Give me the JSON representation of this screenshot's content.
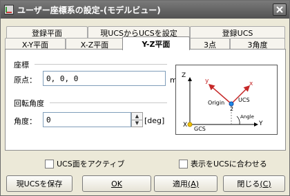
{
  "window": {
    "title": "ユーザー座標系の設定-(モデルビュー)"
  },
  "tabs": {
    "row1": [
      "登録平面",
      "現UCSからUCSを設定",
      "登録UCS"
    ],
    "row2": [
      "X-Y平面",
      "X-Z平面",
      "Y-Z平面",
      "3点",
      "3角度"
    ],
    "active": "Y-Z平面"
  },
  "coords": {
    "group_label": "座標",
    "origin_label": "原点：",
    "origin_value": "0, 0, 0",
    "unit": "m"
  },
  "rotation": {
    "group_label": "回転角度",
    "angle_label": "角度：",
    "angle_value": "0",
    "unit": "[deg]"
  },
  "diagram": {
    "labels": {
      "z_axis": "Z",
      "y_axis": "Y",
      "x_axis": "X",
      "ucs_x": "x",
      "ucs_y": "y",
      "origin": "Origin",
      "origin_num": "2",
      "ucs": "UCS",
      "gcs": "GCS",
      "angle": "Angle"
    },
    "colors": {
      "ucs_axis": "#c62828",
      "origin_dot": "#1e88e5",
      "gcs_origin": "#f2c300"
    }
  },
  "options": {
    "ucs_active": {
      "label": "UCS面をアクティブ",
      "checked": false
    },
    "align_display": {
      "label": "表示をUCSに合わせる",
      "checked": false
    }
  },
  "buttons": {
    "save_ucs": "現UCSを保存",
    "ok": "OK",
    "apply": "適用",
    "apply_key": "(A)",
    "close": "閉じる",
    "close_key": "(C)"
  },
  "icons": {
    "title": "coordinate-system-icon",
    "close": "close-icon",
    "spin_up": "spin-up-icon",
    "spin_down": "spin-down-icon"
  }
}
